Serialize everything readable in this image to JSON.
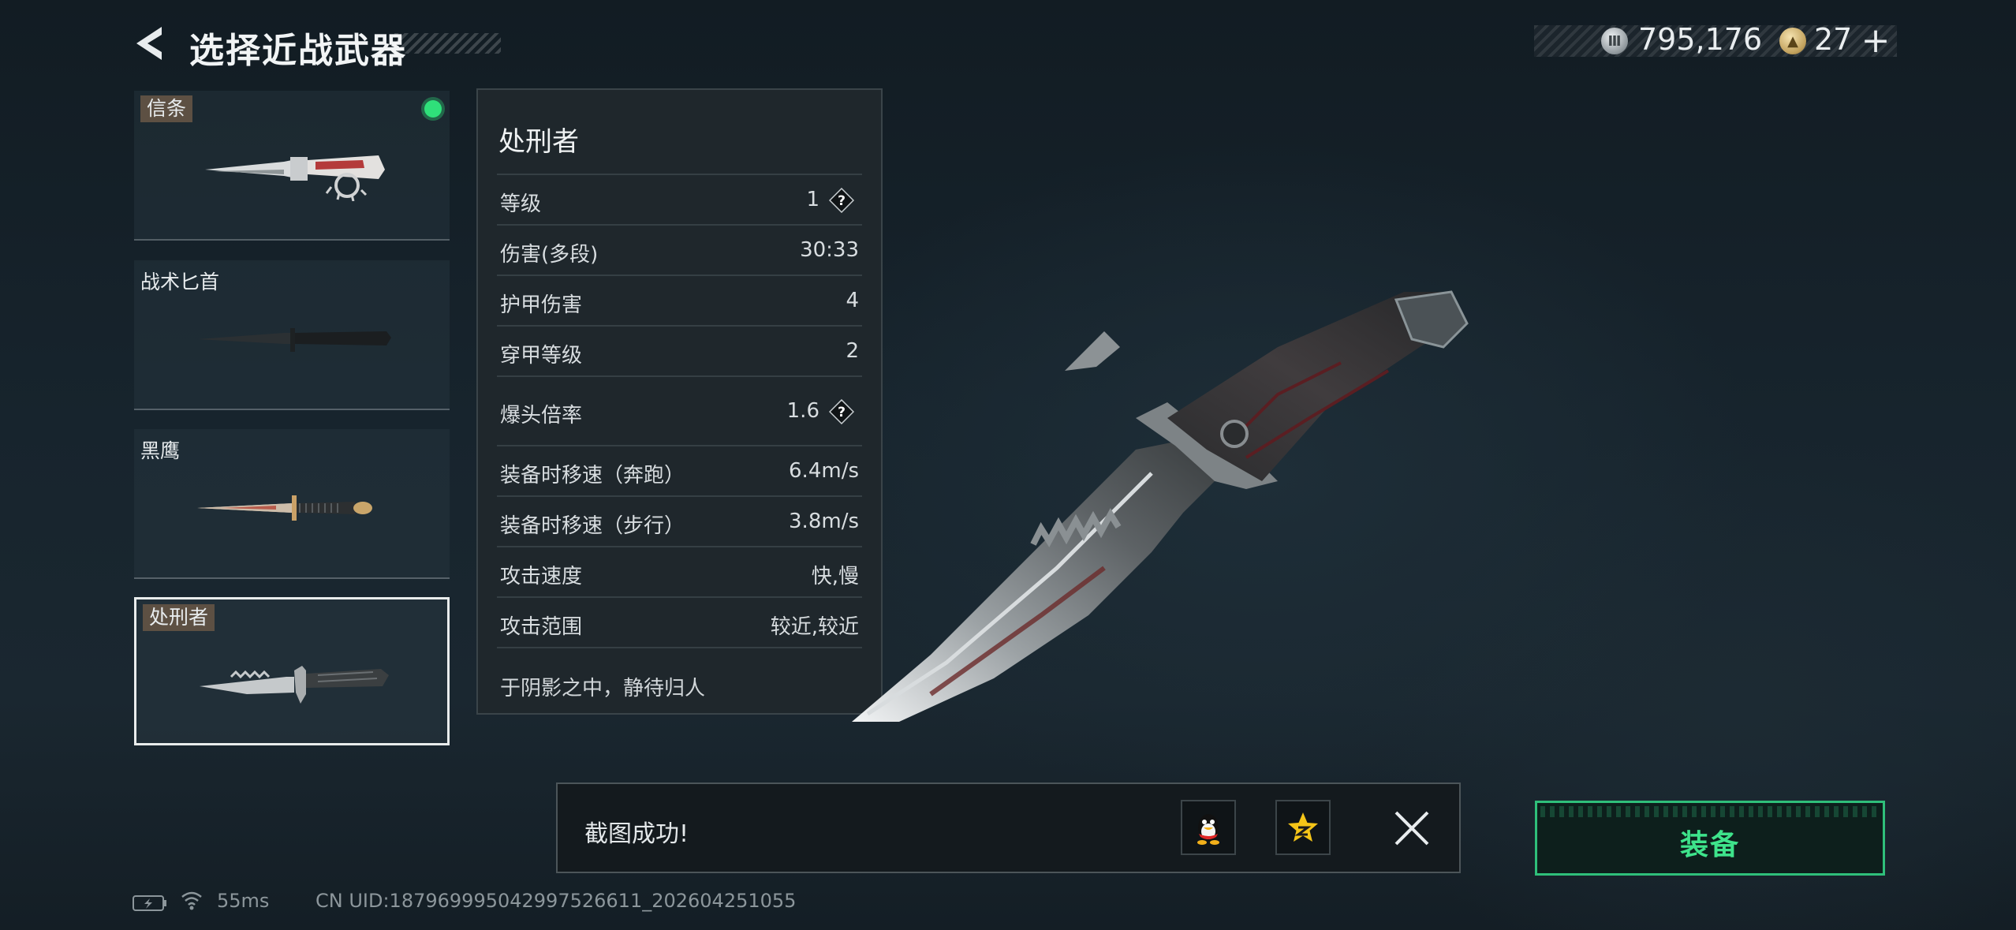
{
  "header": {
    "title": "选择近战武器",
    "back_icon": "back-arrow-icon",
    "currency": {
      "money_icon": "silver-coin-icon",
      "money": "795,176",
      "token_icon": "gold-coin-icon",
      "tokens": "27",
      "plus": "+"
    }
  },
  "weapons": [
    {
      "name": "信条",
      "equipped": true,
      "selected": false
    },
    {
      "name": "战术匕首",
      "equipped": false,
      "selected": false
    },
    {
      "name": "黑鹰",
      "equipped": false,
      "selected": false
    },
    {
      "name": "处刑者",
      "equipped": false,
      "selected": true
    }
  ],
  "stats": {
    "title": "处刑者",
    "rows": [
      {
        "label": "等级",
        "value": "1",
        "help": "?"
      },
      {
        "label": "伤害(多段)",
        "value": "30:33"
      },
      {
        "label": "护甲伤害",
        "value": "4"
      },
      {
        "label": "穿甲等级",
        "value": "2"
      },
      {
        "label": "爆头倍率",
        "value": "1.6",
        "help": "?"
      },
      {
        "label": "装备时移速（奔跑）",
        "value": "6.4m/s"
      },
      {
        "label": "装备时移速（步行）",
        "value": "3.8m/s"
      },
      {
        "label": "攻击速度",
        "value": "快,慢"
      },
      {
        "label": "攻击范围",
        "value": "较近,较近"
      }
    ],
    "lore": "于阴影之中，静待归人"
  },
  "toast": {
    "message": "截图成功!",
    "share_icons": [
      "qq-penguin-icon",
      "qzone-star-icon"
    ],
    "close_icon": "close-icon"
  },
  "equip": {
    "label": "装备"
  },
  "footer": {
    "battery_icon": "battery-charging-icon",
    "wifi_icon": "wifi-icon",
    "latency": "55ms",
    "uid": "CN UID:18796999504299752661​1_202604251055"
  },
  "colors": {
    "accent_green": "#2fbf7a",
    "equip_text": "#3ee38b",
    "equipped_dot": "#2fe07a",
    "tag_bg": "#5d5043"
  }
}
